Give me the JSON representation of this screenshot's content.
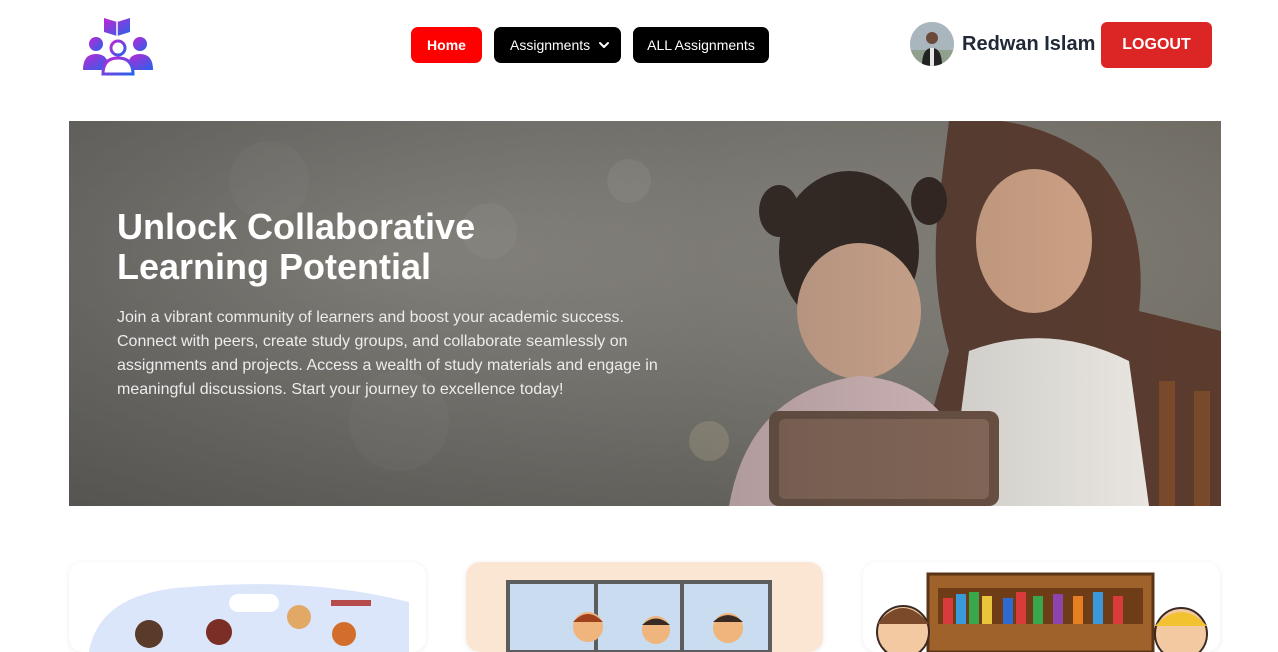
{
  "nav": {
    "home_label": "Home",
    "assignments_label": "Assignments",
    "all_assignments_label": "ALL Assignments"
  },
  "user": {
    "name": "Redwan Islam",
    "logout_label": "LOGOUT"
  },
  "hero": {
    "title_line1": "Unlock Collaborative",
    "title_line2": "Learning Potential",
    "description": "Join a vibrant community of learners and boost your academic success. Connect with peers, create study groups, and collaborate seamlessly on assignments and projects. Access a wealth of study materials and engage in meaningful discussions. Start your journey to excellence today!"
  },
  "colors": {
    "active_nav": "#ff0000",
    "nav_button": "#000000",
    "logout": "#dc2626",
    "logo_gradient_start": "#c026d3",
    "logo_gradient_end": "#2563eb"
  },
  "icons": {
    "logo": "group-study-logo-icon",
    "dropdown": "chevron-down-icon"
  }
}
